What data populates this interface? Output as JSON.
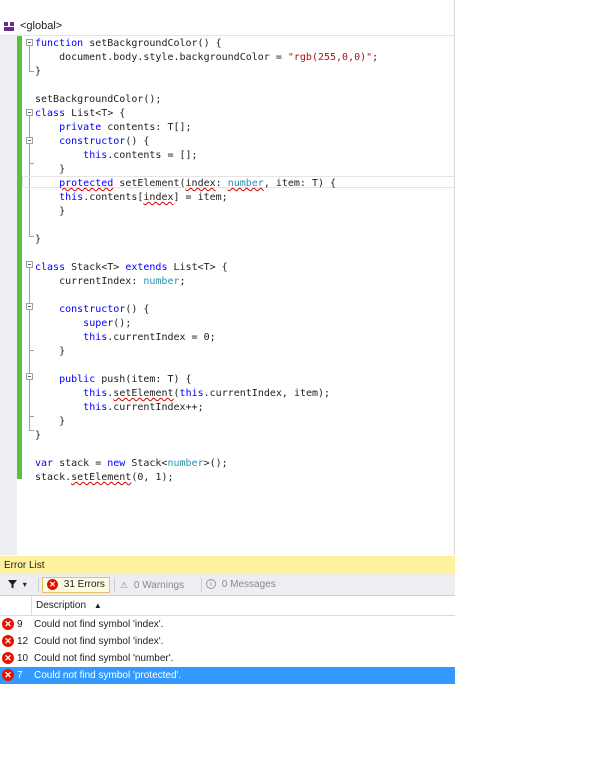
{
  "editor": {
    "nav_scope": "<global>",
    "code_lines": [
      "function setBackgroundColor() {",
      "    document.body.style.backgroundColor = \"rgb(255,0,0)\";",
      "}",
      "",
      "setBackgroundColor();",
      "class List<T> {",
      "    private contents: T[];",
      "    constructor() {",
      "        this.contents = [];",
      "    }",
      "    protected setElement(index: number, item: T) {",
      "    this.contents[index] = item;",
      "    }",
      "",
      "}",
      "",
      "class Stack<T> extends List<T> {",
      "    currentIndex: number;",
      "",
      "    constructor() {",
      "        super();",
      "        this.currentIndex = 0;",
      "    }",
      "",
      "    public push(item: T) {",
      "        this.setElement(this.currentIndex, item);",
      "        this.currentIndex++;",
      "    }",
      "}",
      "",
      "var stack = new Stack<number>();",
      "stack.setElement(0, 1);"
    ]
  },
  "error_list": {
    "title": "Error List",
    "filter_icon": "funnel-icon",
    "errors_label": "31 Errors",
    "warnings_label": "0 Warnings",
    "messages_label": "0 Messages",
    "column_description": "Description",
    "rows": [
      {
        "line": "9",
        "description": "Could not find symbol 'index'.",
        "selected": false
      },
      {
        "line": "12",
        "description": "Could not find symbol 'index'.",
        "selected": false
      },
      {
        "line": "10",
        "description": "Could not find symbol 'number'.",
        "selected": false
      },
      {
        "line": "7",
        "description": "Could not find symbol 'protected'.",
        "selected": true
      }
    ],
    "colors": {
      "title_bg": "#fff29d",
      "selected_row": "#3399ff",
      "error_icon": "#e51400",
      "change_bar": "#58c13a"
    }
  }
}
